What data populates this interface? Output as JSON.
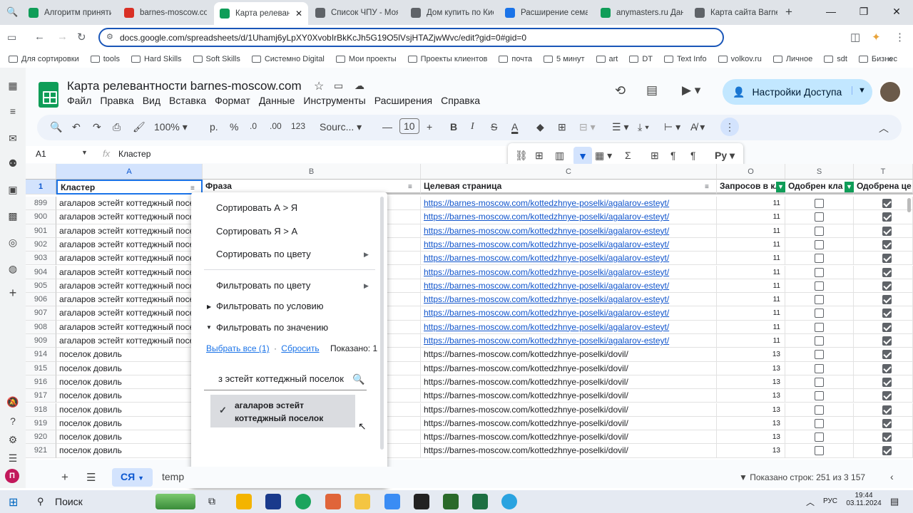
{
  "browser": {
    "tabs": [
      {
        "label": "Алгоритм принятия",
        "color": "#0f9d58"
      },
      {
        "label": "barnes-moscow.com",
        "color": "#d93025"
      },
      {
        "label": "Карта релевант",
        "color": "#0f9d58",
        "active": true
      },
      {
        "label": "Список ЧПУ - Моя к",
        "color": "#5f6368"
      },
      {
        "label": "Дом купить по Киев",
        "color": "#5f6368"
      },
      {
        "label": "Расширение семант",
        "color": "#1a73e8"
      },
      {
        "label": "anymasters.ru Данны",
        "color": "#0f9d58"
      },
      {
        "label": "Карта сайта Barnes",
        "color": "#5f6368"
      }
    ],
    "new_tab": "+",
    "url": "docs.google.com/spreadsheets/d/1Uhamj6yLpXY0XvobIrBkKcJh5G19O5lVsjHTAZjwWvc/edit?gid=0#gid=0",
    "bookmarks": [
      "Для сортировки",
      "tools",
      "Hard Skills",
      "Soft Skills",
      "Системно Digital",
      "Мои проекты",
      "Проекты клиентов",
      "почта",
      "5 минут",
      "art",
      "DT",
      "Text Info",
      "volkov.ru",
      "Личное",
      "sdt",
      "Бизнес"
    ]
  },
  "sheet": {
    "title": "Карта релевантности barnes-moscow.com",
    "menu": [
      "Файл",
      "Правка",
      "Вид",
      "Вставка",
      "Формат",
      "Данные",
      "Инструменты",
      "Расширения",
      "Справка"
    ],
    "share_label": "Настройки Доступа",
    "zoom": "100%",
    "currency": "р.",
    "percent": "%",
    "dec_minus": ".0",
    "dec_plus": ".00",
    "num_format": "123",
    "font": "Sourc...",
    "font_size": "10",
    "cell_ref": "A1",
    "formula": "Кластер",
    "columns": [
      "A",
      "B",
      "C",
      "O",
      "S",
      "T"
    ],
    "headers": {
      "a": "Кластер",
      "b": "Фраза",
      "c": "Целевая страница",
      "o": "Запросов в кл",
      "s": "Одобрен кла",
      "t": "Одобрена це"
    },
    "row1": "1",
    "rows": [
      {
        "n": "899",
        "a": "агаларов эстейт коттеджный посел",
        "b": "",
        "c": "https://barnes-moscow.com/kottedzhnye-poselki/agalarov-esteyt/",
        "link": true,
        "o": "11",
        "s": false,
        "t": true
      },
      {
        "n": "900",
        "a": "агаларов эстейт коттеджный посел",
        "b": "",
        "c": "https://barnes-moscow.com/kottedzhnye-poselki/agalarov-esteyt/",
        "link": true,
        "o": "11",
        "s": false,
        "t": true
      },
      {
        "n": "901",
        "a": "агаларов эстейт коттеджный посел",
        "b": "ный",
        "c": "https://barnes-moscow.com/kottedzhnye-poselki/agalarov-esteyt/",
        "link": true,
        "o": "11",
        "s": false,
        "t": true
      },
      {
        "n": "902",
        "a": "агаларов эстейт коттеджный посел",
        "b": "",
        "c": "https://barnes-moscow.com/kottedzhnye-poselki/agalarov-esteyt/",
        "link": true,
        "o": "11",
        "s": false,
        "t": true
      },
      {
        "n": "903",
        "a": "агаларов эстейт коттеджный посел",
        "b": "",
        "c": "https://barnes-moscow.com/kottedzhnye-poselki/agalarov-esteyt/",
        "link": true,
        "o": "11",
        "s": false,
        "t": true
      },
      {
        "n": "904",
        "a": "агаларов эстейт коттеджный посел",
        "b": "",
        "c": "https://barnes-moscow.com/kottedzhnye-poselki/agalarov-esteyt/",
        "link": true,
        "o": "11",
        "s": false,
        "t": true
      },
      {
        "n": "905",
        "a": "агаларов эстейт коттеджный посел",
        "b": "",
        "c": "https://barnes-moscow.com/kottedzhnye-poselki/agalarov-esteyt/",
        "link": true,
        "o": "11",
        "s": false,
        "t": true
      },
      {
        "n": "906",
        "a": "агаларов эстейт коттеджный посел",
        "b": "",
        "c": "https://barnes-moscow.com/kottedzhnye-poselki/agalarov-esteyt/",
        "link": true,
        "o": "11",
        "s": false,
        "t": true
      },
      {
        "n": "907",
        "a": "агаларов эстейт коттеджный посел",
        "b": "",
        "c": "https://barnes-moscow.com/kottedzhnye-poselki/agalarov-esteyt/",
        "link": true,
        "o": "11",
        "s": false,
        "t": true
      },
      {
        "n": "908",
        "a": "агаларов эстейт коттеджный посел",
        "b": "",
        "c": "https://barnes-moscow.com/kottedzhnye-poselki/agalarov-esteyt/",
        "link": true,
        "o": "11",
        "s": false,
        "t": true
      },
      {
        "n": "909",
        "a": "агаларов эстейт коттеджный посел",
        "b": "ный сай",
        "c": "https://barnes-moscow.com/kottedzhnye-poselki/agalarov-esteyt/",
        "link": true,
        "o": "11",
        "s": false,
        "t": true
      },
      {
        "n": "914",
        "a": "поселок довиль",
        "b": "",
        "c": "https://barnes-moscow.com/kottedzhnye-poselki/dovil/",
        "link": false,
        "o": "13",
        "s": false,
        "t": true
      },
      {
        "n": "915",
        "a": "поселок довиль",
        "b": "",
        "c": "https://barnes-moscow.com/kottedzhnye-poselki/dovil/",
        "link": false,
        "o": "13",
        "s": false,
        "t": true
      },
      {
        "n": "916",
        "a": "поселок довиль",
        "b": "",
        "c": "https://barnes-moscow.com/kottedzhnye-poselki/dovil/",
        "link": false,
        "o": "13",
        "s": false,
        "t": true
      },
      {
        "n": "917",
        "a": "поселок довиль",
        "b": "",
        "c": "https://barnes-moscow.com/kottedzhnye-poselki/dovil/",
        "link": false,
        "o": "13",
        "s": false,
        "t": true
      },
      {
        "n": "918",
        "a": "поселок довиль",
        "b": "",
        "c": "https://barnes-moscow.com/kottedzhnye-poselki/dovil/",
        "link": false,
        "o": "13",
        "s": false,
        "t": true
      },
      {
        "n": "919",
        "a": "поселок довиль",
        "b": "",
        "c": "https://barnes-moscow.com/kottedzhnye-poselki/dovil/",
        "link": false,
        "o": "13",
        "s": false,
        "t": true
      },
      {
        "n": "920",
        "a": "поселок довиль",
        "b": "",
        "c": "https://barnes-moscow.com/kottedzhnye-poselki/dovil/",
        "link": false,
        "o": "13",
        "s": false,
        "t": true
      },
      {
        "n": "921",
        "a": "поселок довиль",
        "b": "",
        "c": "https://barnes-moscow.com/kottedzhnye-poselki/dovil/",
        "link": false,
        "o": "13",
        "s": false,
        "t": true
      }
    ],
    "sheet_tabs": [
      "СЯ",
      "temp"
    ],
    "shown_rows": "Показано строк: 251 из 3 157"
  },
  "filter_menu": {
    "sort_az": "Сортировать А > Я",
    "sort_za": "Сортировать Я > А",
    "sort_color": "Сортировать по цвету",
    "filter_color": "Фильтровать по цвету",
    "filter_condition": "Фильтровать по условию",
    "filter_value": "Фильтровать по значению",
    "select_all": "Выбрать все (1)",
    "separator": "·",
    "reset": "Сбросить",
    "shown": "Показано: 1",
    "search_value": "з эстейт коттеджный поселок",
    "value_item": "агаларов эстейт коттеджный поселок"
  },
  "taskbar": {
    "search": "Поиск",
    "lang": "РУС",
    "time": "19:44",
    "date": "03.11.2024"
  }
}
